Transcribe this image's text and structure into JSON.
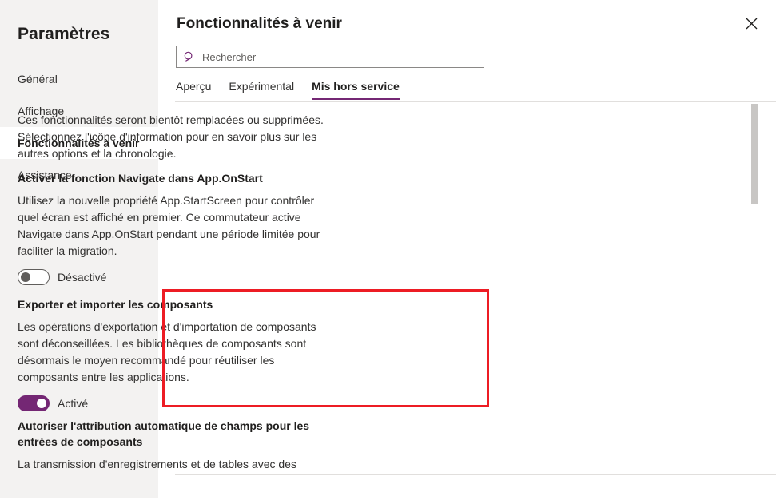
{
  "sidebar": {
    "title": "Paramètres",
    "items": [
      {
        "label": "Général",
        "selected": false
      },
      {
        "label": "Affichage",
        "selected": false
      },
      {
        "label": "Fonctionnalités à venir",
        "selected": true
      },
      {
        "label": "Assistance",
        "selected": false
      }
    ]
  },
  "panel": {
    "title": "Fonctionnalités à venir",
    "close_icon": "close-icon"
  },
  "search": {
    "icon": "search-icon",
    "placeholder": "Rechercher",
    "value": ""
  },
  "tabs": [
    {
      "label": "Aperçu",
      "active": false
    },
    {
      "label": "Expérimental",
      "active": false
    },
    {
      "label": "Mis hors service",
      "active": true
    }
  ],
  "content": {
    "intro": "Ces fonctionnalités seront bientôt remplacées ou supprimées. Sélectionnez l'icône d'information pour en savoir plus sur les autres options et la chronologie.",
    "features": [
      {
        "heading": "Activer la fonction Navigate dans App.OnStart",
        "description": "Utilisez la nouvelle propriété App.StartScreen pour contrôler quel écran est affiché en premier. Ce commutateur active Navigate dans App.OnStart pendant une période limitée pour faciliter la migration.",
        "toggle_state": "off",
        "toggle_label": "Désactivé"
      },
      {
        "heading": "Exporter et importer les composants",
        "description": "Les opérations d'exportation et d'importation de composants sont déconseillées. Les bibliothèques de composants sont désormais le moyen recommandé pour réutiliser les composants entre les applications.",
        "toggle_state": "on",
        "toggle_label": "Activé"
      },
      {
        "heading": "Autoriser l'attribution automatique de champs pour les entrées de composants",
        "description": "La transmission d'enregistrements et de tables avec des",
        "toggle_state": null,
        "toggle_label": null
      }
    ]
  },
  "colors": {
    "accent_purple": "#742774",
    "highlight_red": "#ed1c24",
    "sidebar_bg": "#f3f2f1",
    "divider": "#e1dfdd",
    "scrollbar_thumb": "#c8c6c4"
  }
}
